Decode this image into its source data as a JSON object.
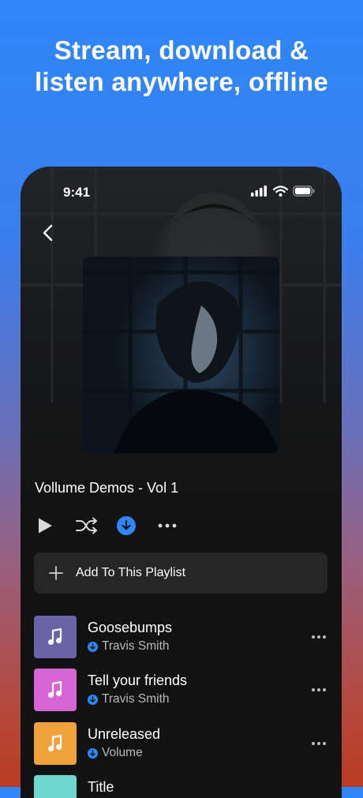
{
  "headline": {
    "line1": "Stream, download &",
    "line2": "listen anywhere, offline"
  },
  "status_bar": {
    "time": "9:41",
    "icons": [
      "signal-icon",
      "wifi-icon",
      "battery-icon"
    ]
  },
  "playlist": {
    "title": "Vollume Demos - Vol 1",
    "controls": [
      "play-icon",
      "shuffle-icon",
      "download-icon",
      "more-icon"
    ],
    "add_label": "Add To This Playlist"
  },
  "tracks": [
    {
      "title": "Goosebumps",
      "artist": "Travis Smith",
      "art_color": "#6a63a6"
    },
    {
      "title": "Tell your friends",
      "artist": "Travis Smith",
      "art_color": "#d664d2"
    },
    {
      "title": "Unreleased",
      "artist": "Volume",
      "art_color": "#f0a23d"
    },
    {
      "title": "Title",
      "artist": "",
      "art_color": "#6cd8cf"
    }
  ],
  "colors": {
    "accent": "#2f86f7",
    "phone_bg": "#121212",
    "button_bg": "#262626"
  }
}
